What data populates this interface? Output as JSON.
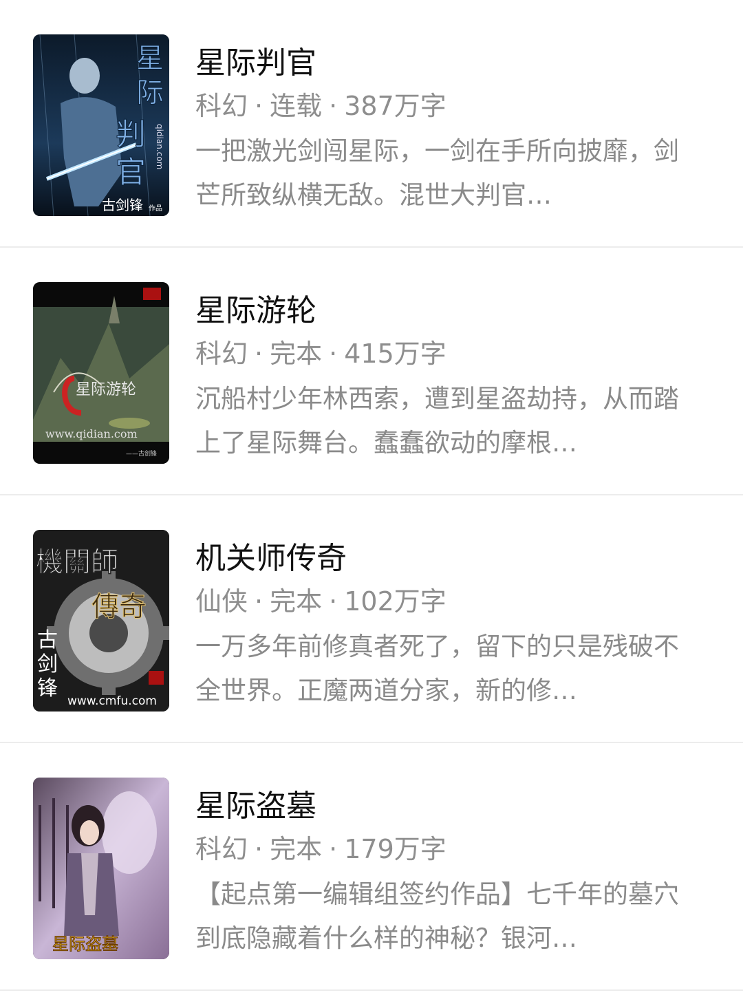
{
  "books": [
    {
      "title": "星际判官",
      "genre": "科幻",
      "status": "连载",
      "words": "387万字",
      "description": "一把激光剑闯星际，一剑在手所向披靡，剑芒所致纵横无敌。混世大判官…",
      "cover_text": [
        "星",
        "际",
        "判",
        "官",
        "qidian.com",
        "古剑锋",
        "作品"
      ]
    },
    {
      "title": "星际游轮",
      "genre": "科幻",
      "status": "完本",
      "words": "415万字",
      "description": "沉船村少年林西索，遭到星盗劫持，从而踏上了星际舞台。蠢蠢欲动的摩根…",
      "cover_text": [
        "星际游轮",
        "www.qidian.com",
        "——古剑锋"
      ]
    },
    {
      "title": "机关师传奇",
      "genre": "仙侠",
      "status": "完本",
      "words": "102万字",
      "description": "一万多年前修真者死了，留下的只是残破不全世界。正魔两道分家，新的修…",
      "cover_text": [
        "機關師",
        "傳奇",
        "古",
        "剑",
        "锋",
        "www.cmfu.com"
      ]
    },
    {
      "title": "星际盗墓",
      "genre": "科幻",
      "status": "完本",
      "words": "179万字",
      "description": "【起点第一编辑组签约作品】七千年的墓穴到底隐藏着什么样的神秘？银河…",
      "cover_text": [
        "星际盗墓"
      ]
    }
  ],
  "separator": "·"
}
